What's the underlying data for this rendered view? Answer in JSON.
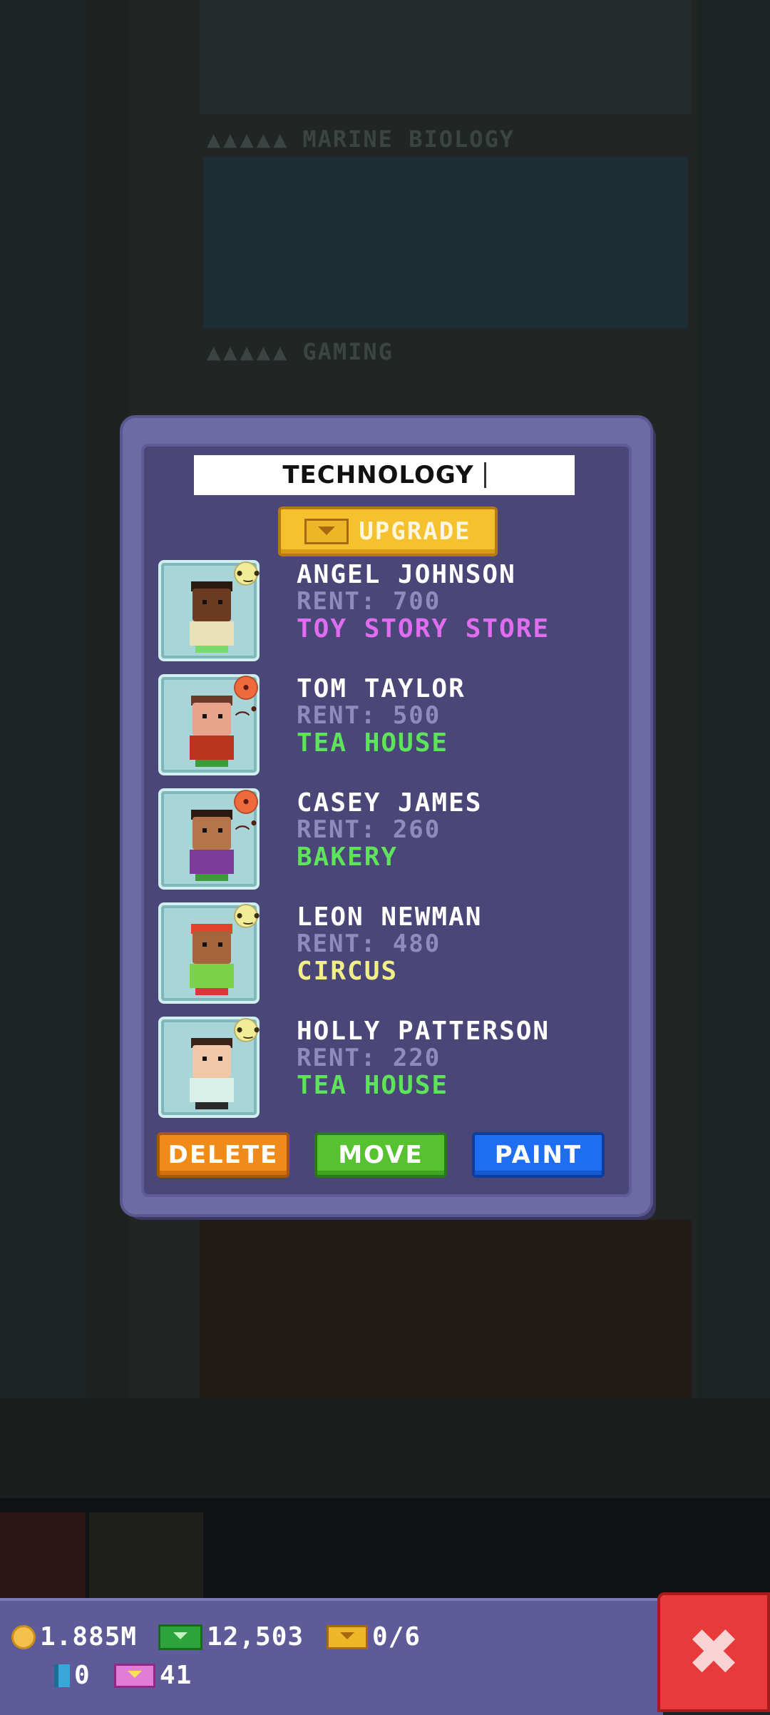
{
  "background": {
    "floors": [
      {
        "name": "MARINE BIOLOGY"
      },
      {
        "name": "GAMING"
      }
    ]
  },
  "dialog": {
    "floor_name": "TECHNOLOGY",
    "upgrade_label": "UPGRADE",
    "residents": [
      {
        "name": "ANGEL JOHNSON",
        "rent": "RENT: 700",
        "job": "TOY STORY STORE",
        "job_color": "#e06cf0",
        "mood": "neutral",
        "skin": "#6b3b22",
        "hair": "#2a1a10",
        "shirt": "#e9e0b8",
        "legs": "#7bd86b"
      },
      {
        "name": "TOM TAYLOR",
        "rent": "RENT: 500",
        "job": "TEA HOUSE",
        "job_color": "#5ee35a",
        "mood": "sad",
        "skin": "#e8a48a",
        "hair": "#6b3a2a",
        "shirt": "#b8341e",
        "legs": "#3f9a3a"
      },
      {
        "name": "CASEY JAMES",
        "rent": "RENT: 260",
        "job": "BAKERY",
        "job_color": "#5ee35a",
        "mood": "sad",
        "skin": "#b5754a",
        "hair": "#2b1a10",
        "shirt": "#7b3c9a",
        "legs": "#3f9a3a"
      },
      {
        "name": "LEON NEWMAN",
        "rent": "RENT: 480",
        "job": "CIRCUS",
        "job_color": "#f2ee8a",
        "mood": "neutral",
        "skin": "#a4643c",
        "hair": "#e5422a",
        "shirt": "#7dd347",
        "legs": "#d43a3a"
      },
      {
        "name": "HOLLY PATTERSON",
        "rent": "RENT: 220",
        "job": "TEA HOUSE",
        "job_color": "#5ee35a",
        "mood": "neutral",
        "skin": "#f0c8a8",
        "hair": "#3a2418",
        "shirt": "#d8f0e8",
        "legs": "#2a2a2a"
      }
    ],
    "buttons": {
      "delete": "DELETE",
      "move": "MOVE",
      "paint": "PAINT"
    }
  },
  "status_bar": {
    "coins": "1.885M",
    "cash": "12,503",
    "bux_progress": "0/6",
    "tickets": "0",
    "golden_tickets": "41"
  },
  "icons": {
    "coin": "coin-icon",
    "cash": "cash-icon",
    "bux": "bux-icon",
    "ticket": "ticket-icon",
    "golden_ticket": "golden-ticket-icon",
    "close": "close-icon",
    "mood_neutral": "neutral-face-icon",
    "mood_sad": "sad-face-icon"
  },
  "colors": {
    "panel": "#4a4778",
    "delete": "#f08b1a",
    "move": "#56c230",
    "paint": "#1f6df0",
    "close": "#e83a3a"
  }
}
